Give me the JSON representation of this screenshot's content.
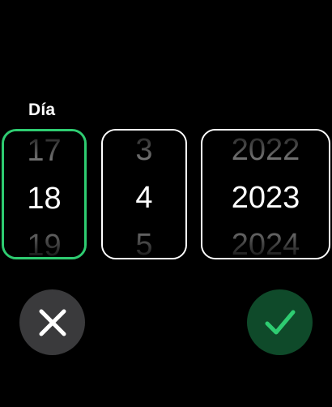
{
  "colors": {
    "background": "#000000",
    "active_border": "#2ecc71",
    "inactive_border": "#ffffff",
    "faded_text": "#8f8f8f",
    "cancel_button_bg": "#3a3a3c",
    "confirm_button_bg": "#0f4a2a",
    "checkmark": "#2ecc71"
  },
  "picker": {
    "active_column_label": "Día",
    "day": {
      "previous": "17",
      "selected": "18",
      "next": "19"
    },
    "month": {
      "previous": "3",
      "selected": "4",
      "next": "5"
    },
    "year": {
      "previous": "2022",
      "selected": "2023",
      "next": "2024"
    }
  },
  "actions": {
    "cancel_icon": "close-icon",
    "confirm_icon": "checkmark-icon"
  }
}
